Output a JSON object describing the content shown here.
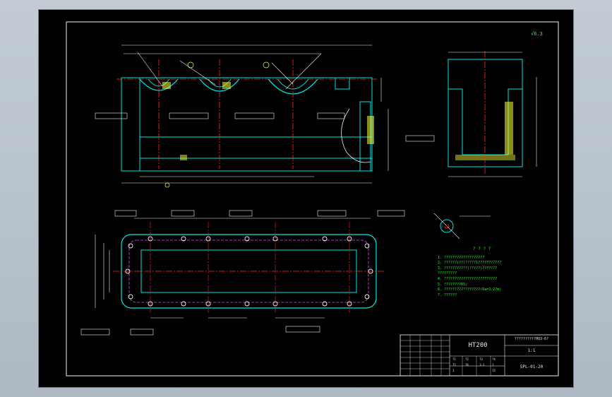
{
  "drawing": {
    "material": "HT200",
    "part_name_label": "??????????HQ3-6?",
    "scale_label": "1:1",
    "drawing_number": "SPL-01-20",
    "roughness_symbol": "6.3",
    "tech_title": "? ? ? ?",
    "tech_notes": [
      "1. ???????????????????",
      "2. ??????(??)?????1???????????",
      "3. ???????????(?????)???????",
      "   ?????????",
      "4. ?????????????????????????",
      "5. ????????R5;",
      "6. ?????????????????(Ra=3.2?m)",
      "7. ??????"
    ],
    "titleblock_small": [
      "?1",
      "?2",
      "?3",
      "?4",
      "?5",
      "?6",
      "1:1",
      "1",
      "1",
      "13"
    ],
    "colors": {
      "frame": "#f0f0f0",
      "outline": "#00e5e5",
      "center": "#ff2a2a",
      "hidden": "#ff33ff",
      "dim": "#ffff33",
      "note": "#22ff22"
    }
  }
}
